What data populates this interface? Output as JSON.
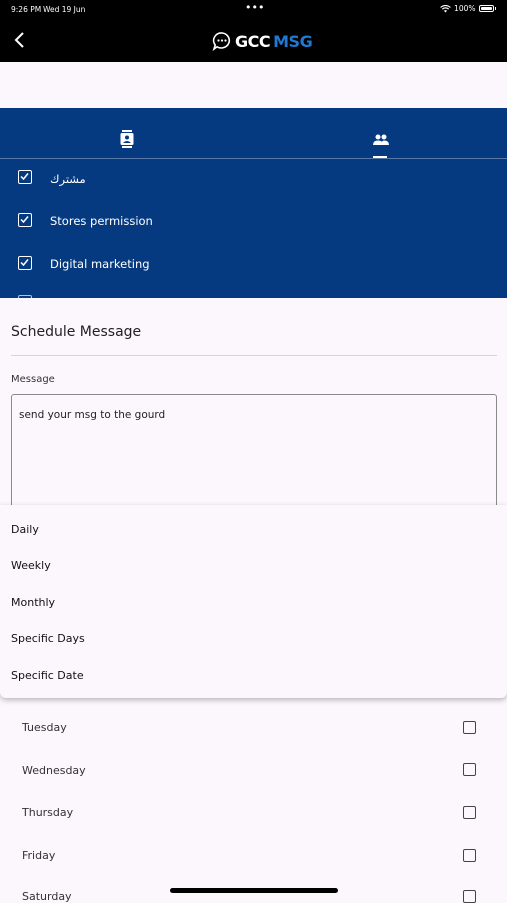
{
  "status_bar": {
    "time": "9:26 PM",
    "date": "Wed 19 Jun",
    "dots": "•••",
    "battery": "100%"
  },
  "header": {
    "logo_gcc": "GCC",
    "logo_msg": "MSG"
  },
  "groups": [
    {
      "label": "مشترك",
      "checked": true
    },
    {
      "label": "Stores permission",
      "checked": true
    },
    {
      "label": "Digital marketing",
      "checked": true
    }
  ],
  "schedule": {
    "title": "Schedule Message",
    "message_label": "Message",
    "message_value": "send your msg to the gourd"
  },
  "frequency_options": [
    "Daily",
    "Weekly",
    "Monthly",
    "Specific Days",
    "Specific Date"
  ],
  "days": [
    "Tuesday",
    "Wednesday",
    "Thursday",
    "Friday",
    "Saturday"
  ],
  "colors": {
    "header_bg": "#000000",
    "panel_blue": "#063a80",
    "logo_accent": "#1e78d4",
    "page_bg": "#fcf7fc"
  }
}
